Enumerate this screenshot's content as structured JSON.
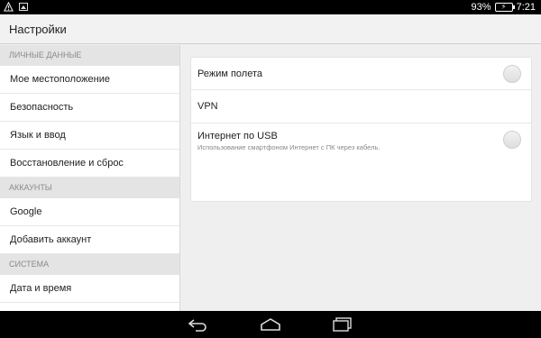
{
  "status_bar": {
    "battery_text": "93%",
    "time": "7:21",
    "left_icons": [
      "warning-icon",
      "image-icon"
    ]
  },
  "app_bar": {
    "title": "Настройки"
  },
  "sidebar": {
    "sections": [
      {
        "header": "ЛИЧНЫЕ ДАННЫЕ",
        "items": [
          "Мое местоположение",
          "Безопасность",
          "Язык и ввод",
          "Восстановление и сброс"
        ]
      },
      {
        "header": "АККАУНТЫ",
        "items": [
          "Google",
          "Добавить аккаунт"
        ]
      },
      {
        "header": "СИСТЕМА",
        "items": [
          "Дата и время"
        ]
      }
    ]
  },
  "content": {
    "airplane": {
      "label": "Режим полета",
      "enabled": false
    },
    "vpn": {
      "label": "VPN"
    },
    "usb_tether": {
      "label": "Интернет по USB",
      "summary": "Использование смартфоном Интернет с ПК через кабель.",
      "enabled": false
    }
  },
  "nav_bar": {
    "buttons": [
      "back-icon",
      "home-icon",
      "recents-icon"
    ]
  }
}
